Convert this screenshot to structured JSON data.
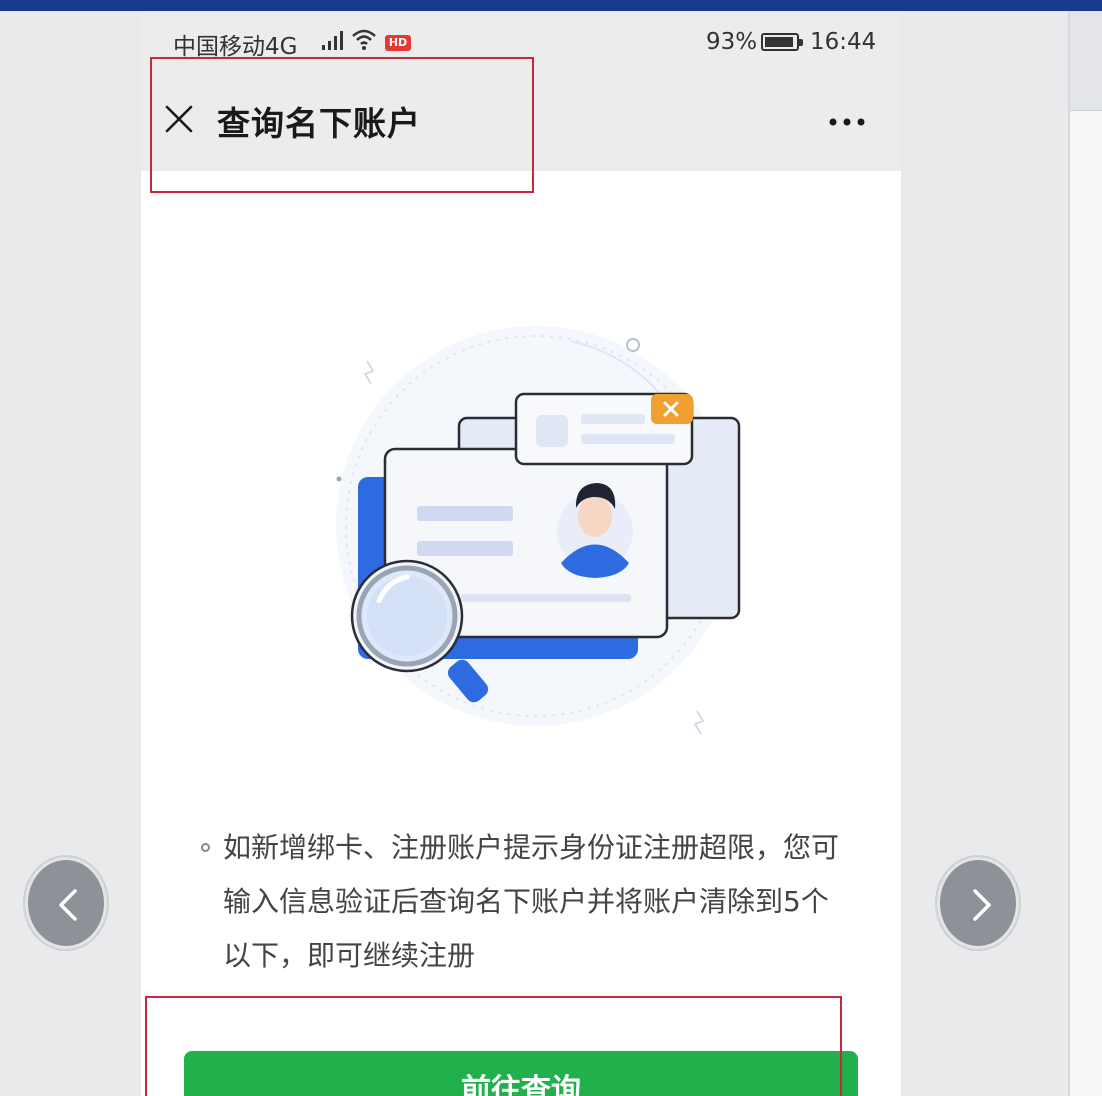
{
  "status_bar": {
    "carrier": "中国移动4G",
    "hd_badge": "HD",
    "battery_percent": "93%",
    "time": "16:44"
  },
  "nav": {
    "title": "查询名下账户",
    "close_icon": "close-icon",
    "more_icon": "more-icon"
  },
  "main": {
    "info_text": "如新增绑卡、注册账户提示身份证注册超限，您可输入信息验证后查询名下账户并将账户清除到5个以下，即可继续注册",
    "button_label": "前往查询"
  },
  "colors": {
    "primary_button": "#21b04b",
    "highlight_box": "#c8283c",
    "illustration_blue": "#2f6be0",
    "warning_badge": "#f0a030"
  },
  "carousel": {
    "prev_icon": "chevron-left-icon",
    "next_icon": "chevron-right-icon"
  }
}
